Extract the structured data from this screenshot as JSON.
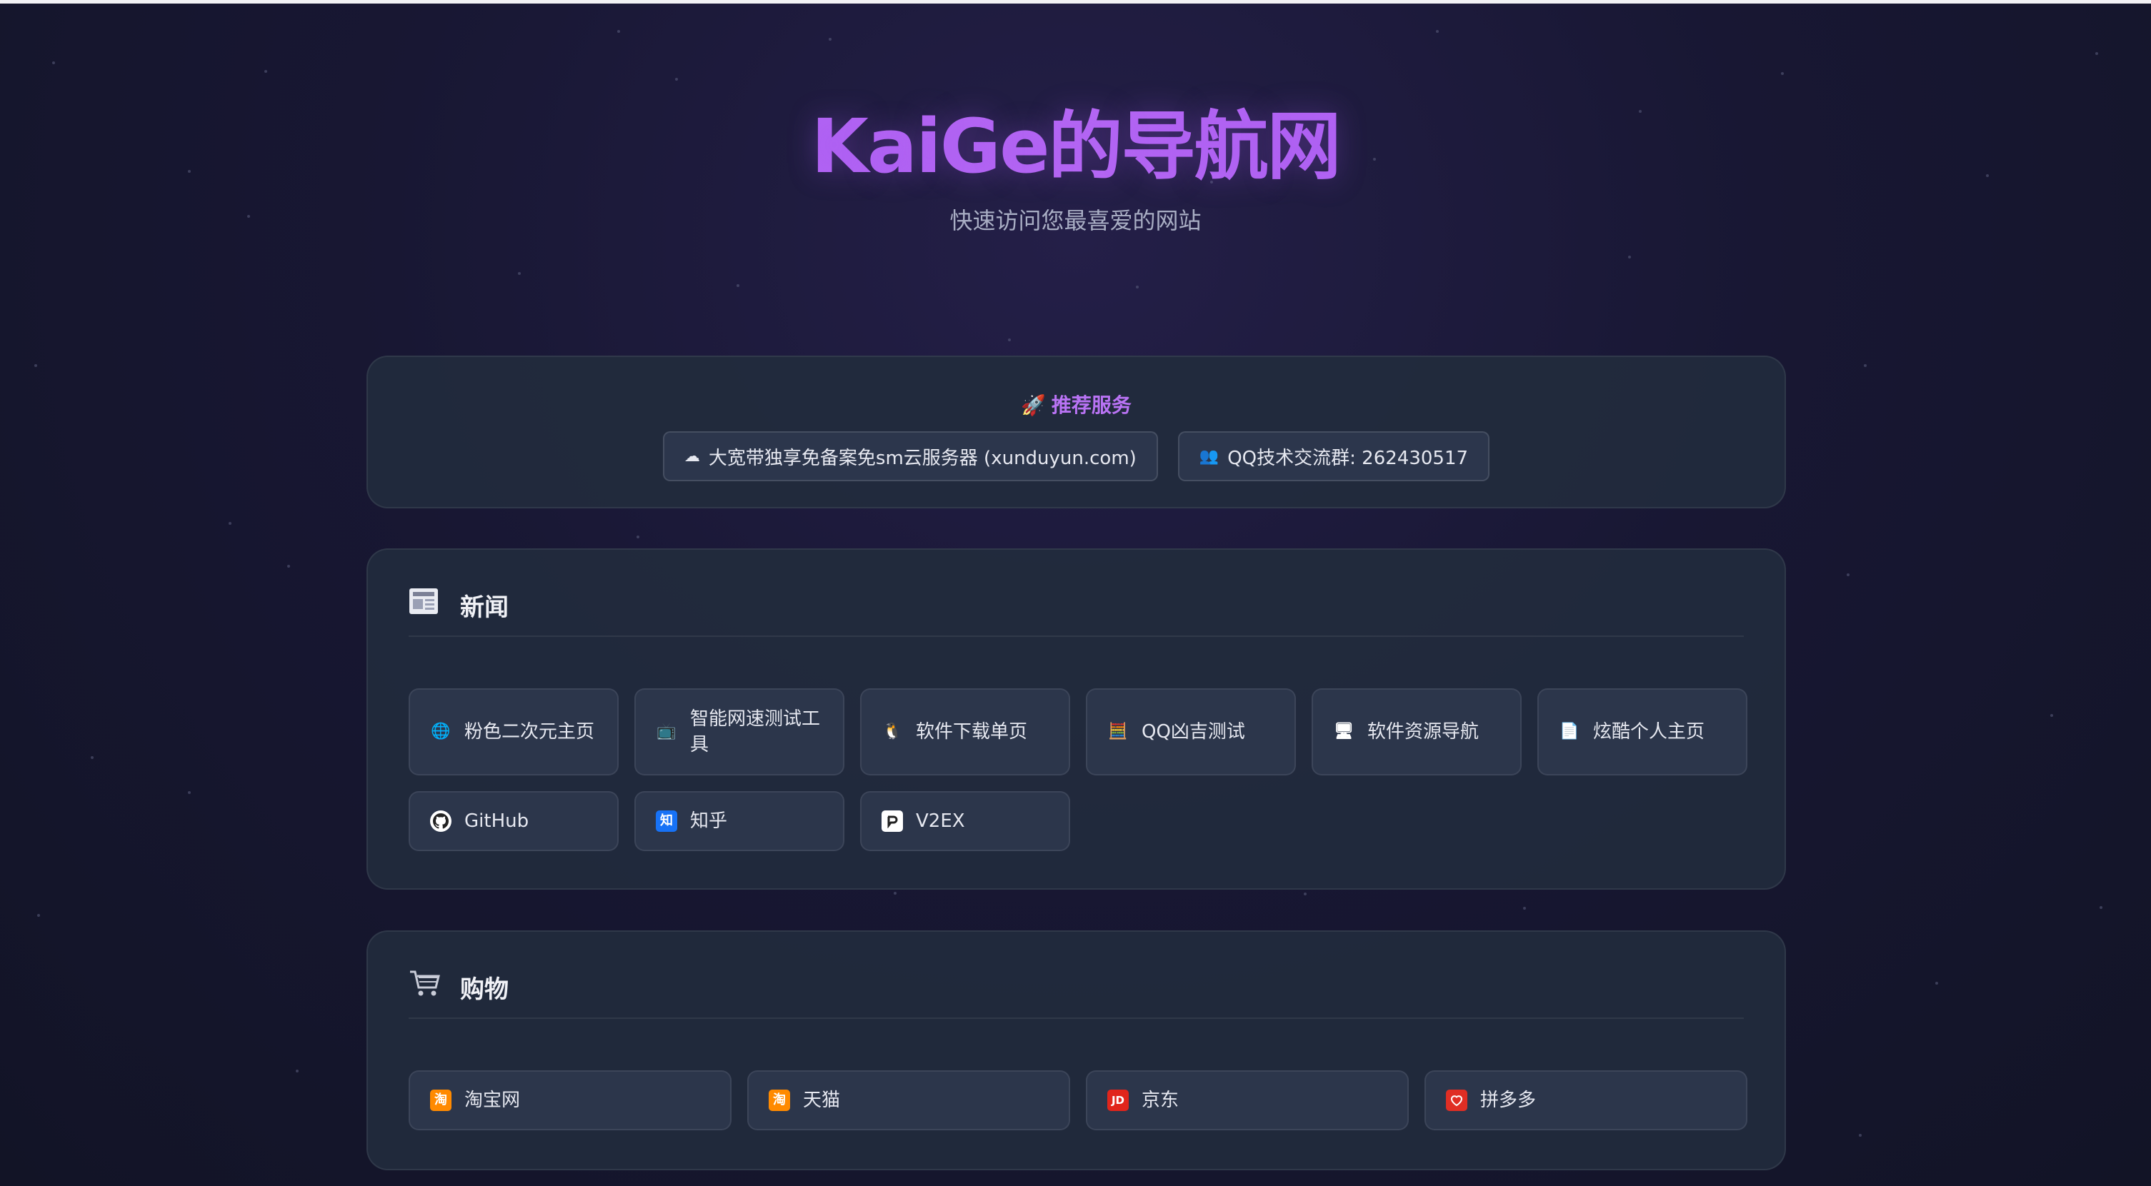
{
  "site": {
    "title": "KaiGe的导航网",
    "subtitle": "快速访问您最喜爱的网站"
  },
  "promo": {
    "title": "推荐服务",
    "icon": "rocket-icon",
    "links": [
      {
        "icon": "cloud-icon",
        "label": "大宽带独享免备案免sm云服务器 (xunduyun.com)"
      },
      {
        "icon": "group-icon",
        "label": "QQ技术交流群: 262430517"
      }
    ]
  },
  "sections": [
    {
      "title": "新闻",
      "icon": "newspaper-icon",
      "items": [
        {
          "icon": "globe-icon",
          "label": "粉色二次元主页"
        },
        {
          "icon": "tv-icon",
          "label": "智能网速测试工具"
        },
        {
          "icon": "penguin-icon",
          "label": "软件下载单页"
        },
        {
          "icon": "abacus-icon",
          "label": "QQ凶吉测试"
        },
        {
          "icon": "monitor-icon",
          "label": "软件资源导航"
        },
        {
          "icon": "document-icon",
          "label": "炫酷个人主页"
        },
        {
          "icon": "github-icon",
          "label": "GitHub"
        },
        {
          "icon": "zhihu-icon",
          "label": "知乎"
        },
        {
          "icon": "v2ex-icon",
          "label": "V2EX"
        }
      ]
    },
    {
      "title": "购物",
      "icon": "shopping-cart-icon",
      "items": [
        {
          "icon": "taobao-icon",
          "label": "淘宝网"
        },
        {
          "icon": "tmall-icon",
          "label": "天猫"
        },
        {
          "icon": "jd-icon",
          "label": "京东"
        },
        {
          "icon": "pinduoduo-icon",
          "label": "拼多多"
        }
      ]
    }
  ],
  "icon_glyphs": {
    "zhihu": "知",
    "taobao": "淘",
    "tmall": "淘",
    "jd": "JD"
  },
  "colors": {
    "accent": "#a557f2",
    "card": "#222b3d",
    "item": "#2c364b",
    "zhihu": "#1772f6",
    "taobao": "#ff8a00",
    "jd": "#e1251b",
    "pinduoduo": "#e02e24"
  }
}
